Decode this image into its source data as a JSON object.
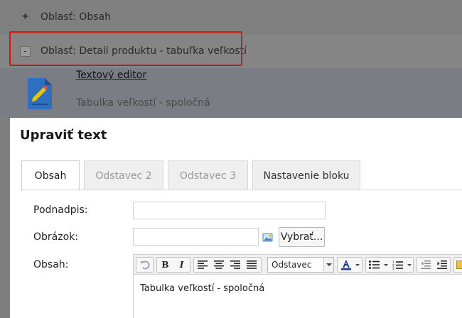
{
  "background": {
    "area_obsah": {
      "toggle": "+",
      "label": "Oblasť: Obsah"
    },
    "area_detail": {
      "toggle": "-",
      "label": "Oblasť: Detail produktu - tabuľka veľkostí"
    },
    "block": {
      "title": "Textový editor",
      "subtitle": "Tabulka veľkostí - spoločná"
    }
  },
  "modal": {
    "title": "Upraviť text",
    "tabs": [
      {
        "label": "Obsah",
        "active": true
      },
      {
        "label": "Odstavec 2",
        "active": false
      },
      {
        "label": "Odstavec 3",
        "active": false
      },
      {
        "label": "Nastavenie bloku",
        "active": false
      }
    ],
    "fields": {
      "subtitle_label": "Podnadpis:",
      "subtitle_value": "",
      "image_label": "Obrázok:",
      "image_value": "",
      "select_button": "Vybrať...",
      "content_label": "Obsah:"
    },
    "editor": {
      "format_value": "Odstavec",
      "content": "Tabulka veľkostí - spoločná",
      "toolbar_icons": [
        "undo-icon",
        "bold-icon",
        "italic-icon",
        "align-left-icon",
        "align-center-icon",
        "align-right-icon",
        "align-justify-icon",
        "font-color-icon",
        "bullet-list-icon",
        "numbered-list-icon",
        "outdent-icon",
        "indent-icon"
      ]
    }
  },
  "colors": {
    "highlight": "#e01010",
    "doc_icon": "#2e6fc0"
  }
}
